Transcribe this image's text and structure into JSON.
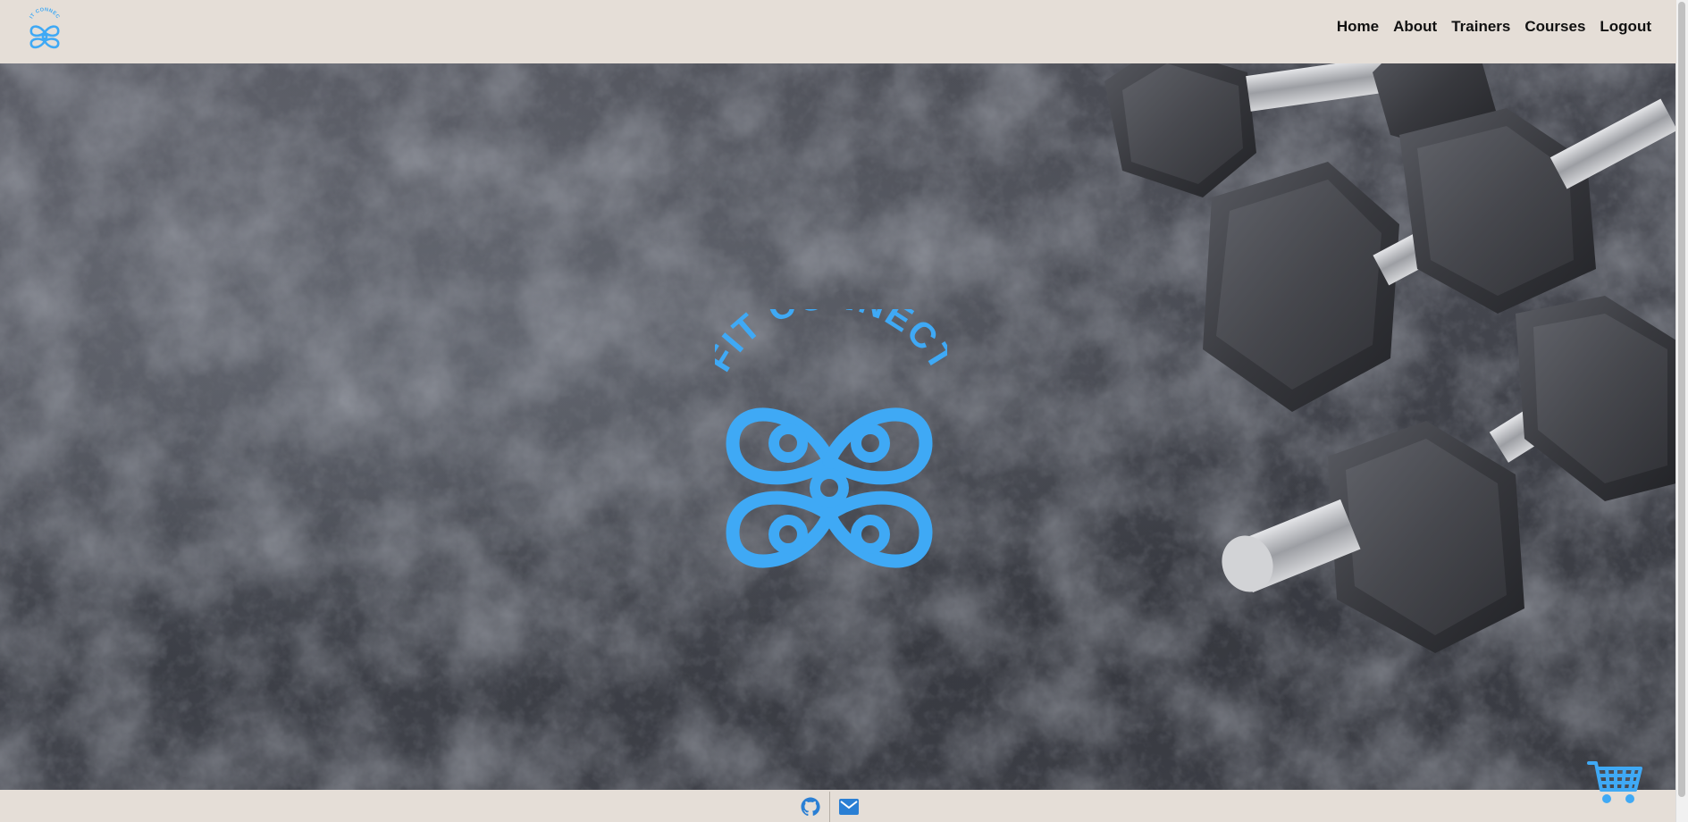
{
  "header": {
    "logo_name": "fit-connect-logo",
    "nav": [
      {
        "label": "Home"
      },
      {
        "label": "About"
      },
      {
        "label": "Trainers"
      },
      {
        "label": "Courses"
      },
      {
        "label": "Logout"
      }
    ]
  },
  "hero": {
    "logo_text": "FIT CONNECT"
  },
  "footer": {
    "icons": [
      "github-icon",
      "mail-icon"
    ]
  },
  "cart": {
    "icon": "shopping-cart-icon"
  },
  "colors": {
    "brand_blue": "#3fa9f5",
    "header_bg": "#e5ded7",
    "footer_icon": "#2a7fd4"
  }
}
